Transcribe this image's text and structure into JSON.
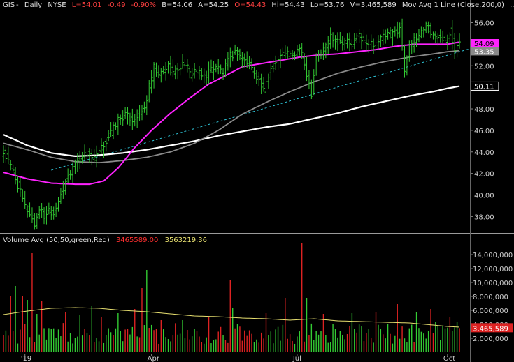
{
  "header": {
    "symbol": "GIS",
    "period": "Daily",
    "exchange": "NYSE",
    "last": "L=54.01",
    "change": "-0.49",
    "change_pct": "-0.90%",
    "bid": "B=54.06",
    "ask": "A=54.25",
    "open": "O=54.43",
    "high": "Hi=54.43",
    "low": "Lo=53.76",
    "volume": "V=3,465,589",
    "ma_label": "Mov Avg 1 Line (Close,200,0)",
    "ma_dots": "..."
  },
  "volume_header": {
    "label": "Volume Avg (50,50,green,Red)",
    "volume_value": "3465589.00",
    "avg_value": "3563219.36"
  },
  "colors": {
    "background": "#000000",
    "up_bar": "#33cc33",
    "down_bar": "#dd2222",
    "ma_magenta": "#ff22ff",
    "ma_gray": "#8a8a8a",
    "ma_white": "#ffffff",
    "trendline": "#2ec4d6",
    "volume_avg": "#e8e070"
  },
  "chart_data": [
    {
      "type": "line",
      "panel": "price",
      "y_ticks": [
        38,
        40,
        42,
        44,
        46,
        48,
        50,
        52,
        54,
        56
      ],
      "y_tick_labels": [
        "38.00",
        "40.00",
        "42.00",
        "44.00",
        "46.00",
        "48.00",
        "50.00",
        "52.00",
        "54.00",
        "56.00"
      ],
      "ylim": [
        36.6,
        57.2
      ],
      "x_tick_labels": [
        {
          "label": "'19",
          "day": 9
        },
        {
          "label": "Apr",
          "day": 62
        },
        {
          "label": "Jul",
          "day": 123
        },
        {
          "label": "Oct",
          "day": 186
        }
      ],
      "num_days": 192,
      "close_anchors": [
        [
          0,
          43.9
        ],
        [
          4,
          42.2
        ],
        [
          7,
          40.2
        ],
        [
          9,
          38.9
        ],
        [
          11,
          38.3
        ],
        [
          13,
          37.2
        ],
        [
          15,
          38.8
        ],
        [
          17,
          38.0
        ],
        [
          19,
          38.7
        ],
        [
          21,
          38.3
        ],
        [
          23,
          39.6
        ],
        [
          26,
          41.2
        ],
        [
          29,
          42.6
        ],
        [
          32,
          43.3
        ],
        [
          35,
          43.9
        ],
        [
          38,
          43.3
        ],
        [
          41,
          44.3
        ],
        [
          44,
          45.4
        ],
        [
          48,
          47.0
        ],
        [
          51,
          47.4
        ],
        [
          54,
          47.0
        ],
        [
          56,
          47.4
        ],
        [
          59,
          47.9
        ],
        [
          61,
          50.0
        ],
        [
          63,
          51.8
        ],
        [
          65,
          51.0
        ],
        [
          67,
          51.6
        ],
        [
          69,
          52.0
        ],
        [
          71,
          51.4
        ],
        [
          74,
          51.9
        ],
        [
          76,
          52.3
        ],
        [
          78,
          51.2
        ],
        [
          80,
          51.6
        ],
        [
          83,
          51.0
        ],
        [
          85,
          51.2
        ],
        [
          87,
          51.7
        ],
        [
          89,
          52.0
        ],
        [
          92,
          51.4
        ],
        [
          95,
          52.9
        ],
        [
          98,
          53.3
        ],
        [
          100,
          52.6
        ],
        [
          103,
          52.1
        ],
        [
          106,
          51.1
        ],
        [
          109,
          49.6
        ],
        [
          112,
          51.8
        ],
        [
          115,
          52.6
        ],
        [
          118,
          53.3
        ],
        [
          121,
          52.8
        ],
        [
          124,
          53.7
        ],
        [
          127,
          51.3
        ],
        [
          129,
          49.5
        ],
        [
          131,
          53.0
        ],
        [
          134,
          53.5
        ],
        [
          137,
          54.8
        ],
        [
          140,
          54.2
        ],
        [
          143,
          54.4
        ],
        [
          146,
          53.8
        ],
        [
          149,
          54.9
        ],
        [
          152,
          53.9
        ],
        [
          155,
          54.1
        ],
        [
          158,
          54.5
        ],
        [
          161,
          54.9
        ],
        [
          164,
          55.1
        ],
        [
          166,
          55.6
        ],
        [
          168,
          51.6
        ],
        [
          170,
          54.0
        ],
        [
          173,
          54.4
        ],
        [
          175,
          55.3
        ],
        [
          177,
          55.8
        ],
        [
          179,
          55.0
        ],
        [
          181,
          54.6
        ],
        [
          183,
          54.9
        ],
        [
          185,
          54.5
        ],
        [
          187,
          55.2
        ],
        [
          189,
          53.6
        ],
        [
          191,
          54.0
        ]
      ],
      "ma_magenta": [
        [
          0,
          42.1
        ],
        [
          10,
          41.5
        ],
        [
          20,
          41.1
        ],
        [
          30,
          41.0
        ],
        [
          36,
          41.0
        ],
        [
          42,
          41.3
        ],
        [
          48,
          42.5
        ],
        [
          55,
          44.4
        ],
        [
          62,
          46.0
        ],
        [
          70,
          47.6
        ],
        [
          78,
          49.0
        ],
        [
          86,
          50.3
        ],
        [
          94,
          51.2
        ],
        [
          100,
          51.9
        ],
        [
          108,
          52.2
        ],
        [
          116,
          52.5
        ],
        [
          124,
          52.8
        ],
        [
          132,
          53.0
        ],
        [
          140,
          53.1
        ],
        [
          148,
          53.3
        ],
        [
          156,
          53.5
        ],
        [
          164,
          53.8
        ],
        [
          172,
          54.0
        ],
        [
          180,
          54.0
        ],
        [
          186,
          54.0
        ],
        [
          191,
          54.2
        ]
      ],
      "ma_gray": [
        [
          0,
          44.8
        ],
        [
          10,
          44.2
        ],
        [
          20,
          43.5
        ],
        [
          30,
          43.1
        ],
        [
          40,
          43.0
        ],
        [
          50,
          43.2
        ],
        [
          60,
          43.5
        ],
        [
          70,
          44.0
        ],
        [
          80,
          44.8
        ],
        [
          90,
          46.0
        ],
        [
          100,
          47.5
        ],
        [
          110,
          48.6
        ],
        [
          120,
          49.6
        ],
        [
          130,
          50.5
        ],
        [
          140,
          51.3
        ],
        [
          150,
          51.9
        ],
        [
          160,
          52.4
        ],
        [
          170,
          52.8
        ],
        [
          180,
          53.1
        ],
        [
          186,
          53.3
        ],
        [
          191,
          53.4
        ]
      ],
      "ma_white": [
        [
          0,
          45.6
        ],
        [
          10,
          44.6
        ],
        [
          20,
          43.9
        ],
        [
          30,
          43.6
        ],
        [
          40,
          43.7
        ],
        [
          50,
          43.9
        ],
        [
          60,
          44.2
        ],
        [
          70,
          44.6
        ],
        [
          80,
          45.0
        ],
        [
          90,
          45.5
        ],
        [
          100,
          45.9
        ],
        [
          110,
          46.3
        ],
        [
          120,
          46.6
        ],
        [
          130,
          47.1
        ],
        [
          140,
          47.6
        ],
        [
          150,
          48.2
        ],
        [
          160,
          48.7
        ],
        [
          170,
          49.2
        ],
        [
          180,
          49.6
        ],
        [
          186,
          49.9
        ],
        [
          191,
          50.1
        ]
      ],
      "trendline": [
        [
          20,
          42.3
        ],
        [
          191,
          53.3
        ]
      ],
      "price_labels": [
        {
          "text": "54.09",
          "value": 54.09,
          "color": "#ff22ff"
        },
        {
          "text": "53.35",
          "value": 53.35,
          "color": "#8a8a8a"
        },
        {
          "text": "50.11",
          "value": 50.11,
          "color": "#ffffff"
        }
      ]
    },
    {
      "type": "bar",
      "panel": "volume",
      "y_ticks": [
        2000000,
        4000000,
        6000000,
        8000000,
        10000000,
        12000000,
        14000000
      ],
      "y_tick_labels": [
        "2,000,000",
        "4,000,000",
        "6,000,000",
        "8,000,000",
        "10,000,000",
        "12,000,000",
        "14,000,000"
      ],
      "ylim": [
        0,
        15500000
      ],
      "last_volume_label": "3,465,589",
      "last_volume": 3465589,
      "spikes": [
        [
          3,
          8.0
        ],
        [
          5,
          9.5
        ],
        [
          8,
          8.0
        ],
        [
          10,
          7.5
        ],
        [
          12,
          14.2
        ],
        [
          14,
          5.5
        ],
        [
          16,
          7.4
        ],
        [
          26,
          5.8
        ],
        [
          32,
          5.3
        ],
        [
          37,
          6.6
        ],
        [
          41,
          5.1
        ],
        [
          48,
          5.6
        ],
        [
          55,
          6.2
        ],
        [
          58,
          9.2
        ],
        [
          60,
          11.8
        ],
        [
          66,
          4.6
        ],
        [
          75,
          4.6
        ],
        [
          86,
          5.1
        ],
        [
          95,
          10.4
        ],
        [
          96,
          6.3
        ],
        [
          110,
          5.6
        ],
        [
          118,
          7.8
        ],
        [
          125,
          15.6
        ],
        [
          127,
          7.8
        ],
        [
          134,
          5.5
        ],
        [
          146,
          5.6
        ],
        [
          156,
          5.7
        ],
        [
          165,
          6.9
        ],
        [
          173,
          5.7
        ],
        [
          179,
          6.2
        ],
        [
          181,
          4.4
        ],
        [
          187,
          5.1
        ],
        [
          190,
          4.4
        ]
      ],
      "down_days": [
        3,
        8,
        12,
        16,
        26,
        41,
        55,
        58,
        66,
        86,
        95,
        110,
        118,
        125,
        134,
        156,
        165,
        179,
        187,
        191
      ],
      "avg_anchors": [
        [
          0,
          5.4
        ],
        [
          10,
          5.9
        ],
        [
          20,
          6.3
        ],
        [
          30,
          6.4
        ],
        [
          40,
          6.3
        ],
        [
          50,
          6.0
        ],
        [
          60,
          5.8
        ],
        [
          70,
          5.5
        ],
        [
          80,
          5.2
        ],
        [
          90,
          5.1
        ],
        [
          100,
          4.9
        ],
        [
          110,
          4.8
        ],
        [
          120,
          4.6
        ],
        [
          130,
          4.8
        ],
        [
          140,
          4.5
        ],
        [
          150,
          4.4
        ],
        [
          160,
          4.3
        ],
        [
          170,
          4.2
        ],
        [
          180,
          3.9
        ],
        [
          186,
          3.7
        ],
        [
          191,
          3.6
        ]
      ]
    }
  ]
}
